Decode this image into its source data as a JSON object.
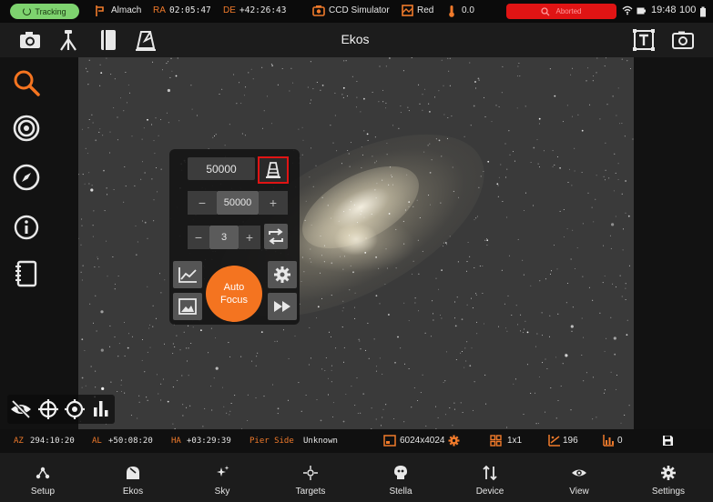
{
  "statusbar": {
    "tracking_label": "Tracking",
    "target_name": "Almach",
    "ra_label": "RA",
    "ra_value": "02:05:47",
    "de_label": "DE",
    "de_value": "+42:26:43",
    "camera_name": "CCD Simulator",
    "filter_name": "Red",
    "temperature": "0.0",
    "abort_label": "Aborted",
    "battery": "100",
    "time": "19:48"
  },
  "toolbar": {
    "title": "Ekos"
  },
  "focus_panel": {
    "exposure_display": "50000",
    "step_value": "50000",
    "step_minus": "−",
    "step_plus": "+",
    "count_value": "3",
    "count_minus": "−",
    "count_plus": "+",
    "autofocus_line1": "Auto",
    "autofocus_line2": "Focus"
  },
  "info_strip": {
    "az_label": "AZ",
    "az_value": "294:10:20",
    "al_label": "AL",
    "al_value": "+50:08:20",
    "ha_label": "HA",
    "ha_value": "+03:29:39",
    "pier_label": "Pier Side",
    "pier_value": "Unknown",
    "resolution": "6024x4024",
    "binning": "1x1",
    "stars": "196",
    "frames": "0"
  },
  "bottom_nav": [
    {
      "label": "Setup",
      "icon": "setup-icon"
    },
    {
      "label": "Ekos",
      "icon": "ekos-icon"
    },
    {
      "label": "Sky",
      "icon": "sky-icon"
    },
    {
      "label": "Targets",
      "icon": "targets-icon"
    },
    {
      "label": "Stella",
      "icon": "stella-icon"
    },
    {
      "label": "Device",
      "icon": "device-icon"
    },
    {
      "label": "View",
      "icon": "view-icon"
    },
    {
      "label": "Settings",
      "icon": "settings-icon"
    }
  ],
  "colors": {
    "accent": "#f47420",
    "tracking": "#7ed36f",
    "abort": "#e01414",
    "highlight_border": "#e01414"
  }
}
